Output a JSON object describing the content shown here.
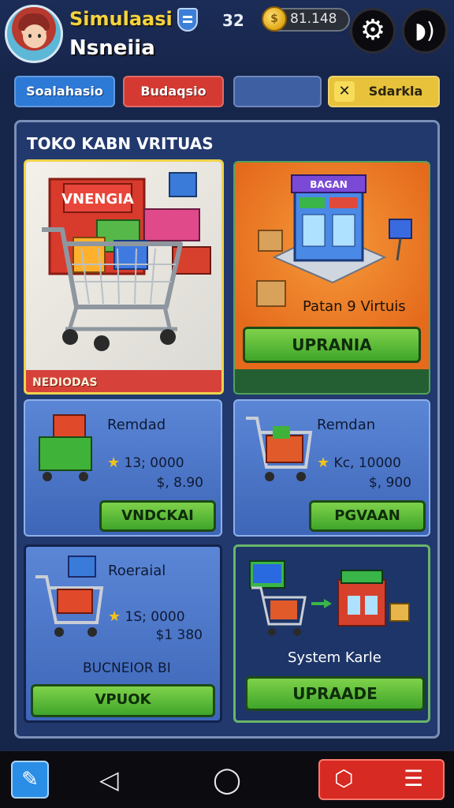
{
  "header": {
    "title": "Simulaasi",
    "subtitle": "Nsneiia",
    "level": "32",
    "coins": "81.148"
  },
  "tabs": [
    {
      "label": "Soalahasio"
    },
    {
      "label": "Budaqsio"
    },
    {
      "label": ""
    },
    {
      "label": "Sdarkla"
    }
  ],
  "store": {
    "title": "TOKO KABN VRITUAS",
    "featured": {
      "art_text": "VNENGIA",
      "label": "NEDIODAS"
    },
    "virtual": {
      "sign": "BAGAN",
      "caption": "Patan 9 Virtuis",
      "button": "UPRANIA"
    },
    "items": [
      {
        "name": "Remdad",
        "stat": "13; 0000",
        "price": "$, 8.90",
        "button": "VNDCKAI"
      },
      {
        "name": "Remdan",
        "stat": "Kc, 10000",
        "price": "$, 900",
        "button": "PGVAAN"
      },
      {
        "name": "Roeraial",
        "stat": "1S; 0000",
        "price": "$1 380",
        "sub": "BUCNEIOR BI",
        "button": "VPUOK"
      }
    ],
    "system": {
      "caption": "System Karle",
      "button": "UPRAADE"
    }
  },
  "colors": {
    "accent_yellow": "#f6d33c",
    "panel": "#22396e",
    "button_green": "#3fa52a",
    "tab_blue": "#2d79d6",
    "tab_red": "#d43a32",
    "tab_yellow": "#e7c23a"
  },
  "icons": [
    "player-avatar",
    "rank-shield-icon",
    "coin-icon",
    "gear-icon",
    "sound-icon",
    "edit-icon",
    "back-icon",
    "home-icon",
    "box-icon",
    "list-icon"
  ]
}
